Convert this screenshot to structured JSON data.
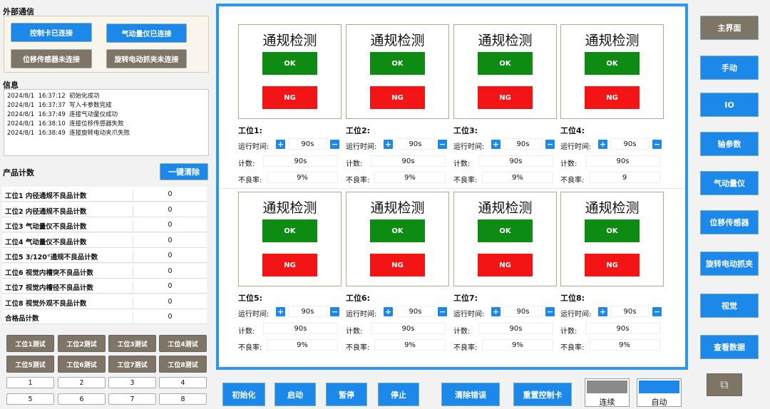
{
  "comm": {
    "title": "外部通信",
    "card_ok": "控制卡已连接",
    "gauge_ok": "气动量仪已连接",
    "disp_no": "位移传感器未连接",
    "grip_no": "旋转电动抓夹未连接"
  },
  "info": {
    "title": "信息",
    "logs": [
      "2024/8/1  16:37:12  初始化成功",
      "2024/8/1  16:37:37  写入卡参数完成",
      "2024/8/1  16:37:49  连接气动量仪成功",
      "2024/8/1  16:38:10  连接位移传感器失败",
      "2024/8/1  16:38:49  连接旋转电动夹爪失败"
    ]
  },
  "count": {
    "title": "产品计数",
    "clear": "一键清除",
    "rows": [
      {
        "label": "工位1  内径通规不良品计数",
        "value": "0"
      },
      {
        "label": "工位2  内径通规不良品计数",
        "value": "0"
      },
      {
        "label": "工位3  气动量仪不良品计数",
        "value": "0"
      },
      {
        "label": "工位4  气动量仪不良品计数",
        "value": "0"
      },
      {
        "label": "工位5  3/120°通规不良品计数",
        "value": "0"
      },
      {
        "label": "工位6  视觉内槽突不良品计数",
        "value": "0"
      },
      {
        "label": "工位7  视觉内槽径不良品计数",
        "value": "0"
      },
      {
        "label": "工位8  视觉外观不良品计数",
        "value": "0"
      },
      {
        "label": "合格品计数",
        "value": "0"
      }
    ]
  },
  "tests": [
    "工位1测试",
    "工位2测试",
    "工位3测试",
    "工位4测试",
    "工位5测试",
    "工位6测试",
    "工位7测试",
    "工位8测试"
  ],
  "nums": [
    "1",
    "2",
    "3",
    "4",
    "5",
    "6",
    "7",
    "8"
  ],
  "stations": [
    {
      "title": "通规检测",
      "ok": "OK",
      "ng": "NG",
      "label": "工位1:",
      "run": "运行时间:",
      "time": "90s",
      "cnt_l": "计数:",
      "cnt": "90s",
      "bad_l": "不良率:",
      "bad": "9%"
    },
    {
      "title": "通规检测",
      "ok": "OK",
      "ng": "NG",
      "label": "工位2:",
      "run": "运行时间:",
      "time": "90s",
      "cnt_l": "计数:",
      "cnt": "90s",
      "bad_l": "不良率:",
      "bad": "9%"
    },
    {
      "title": "通规检测",
      "ok": "OK",
      "ng": "NG",
      "label": "工位3:",
      "run": "运行时间:",
      "time": "90s",
      "cnt_l": "计数:",
      "cnt": "90s",
      "bad_l": "不良率:",
      "bad": "9%"
    },
    {
      "title": "通规检测",
      "ok": "OK",
      "ng": "NG",
      "label": "工位4:",
      "run": "运行时间:",
      "time": "90s",
      "cnt_l": "计数:",
      "cnt": "90s",
      "bad_l": "不良率:",
      "bad": "9"
    },
    {
      "title": "通规检测",
      "ok": "OK",
      "ng": "NG",
      "label": "工位5:",
      "run": "运行时间:",
      "time": "90s",
      "cnt_l": "计数:",
      "cnt": "90s",
      "bad_l": "不良率:",
      "bad": "9%"
    },
    {
      "title": "通规检测",
      "ok": "OK",
      "ng": "NG",
      "label": "工位6:",
      "run": "运行时间:",
      "time": "90s",
      "cnt_l": "计数:",
      "cnt": "90s",
      "bad_l": "不良率:",
      "bad": "9%"
    },
    {
      "title": "通规检测",
      "ok": "OK",
      "ng": "NG",
      "label": "工位7:",
      "run": "运行时间:",
      "time": "90s",
      "cnt_l": "计数:",
      "cnt": "90s",
      "bad_l": "不良率:",
      "bad": "9%"
    },
    {
      "title": "通规检测",
      "ok": "OK",
      "ng": "NG",
      "label": "工位8:",
      "run": "运行时间:",
      "time": "90s",
      "cnt_l": "计数:",
      "cnt": "90s",
      "bad_l": "不良率:",
      "bad": "9%"
    }
  ],
  "bottom": {
    "init": "初始化",
    "start": "启动",
    "pause": "暂停",
    "stop": "停止",
    "clear_err": "清除错误",
    "reset_card": "重置控制卡",
    "cont": "连续",
    "auto": "自动"
  },
  "right": [
    "主界面",
    "手动",
    "IO",
    "轴参数",
    "气动量仪",
    "位移传感器",
    "旋转电动抓夹",
    "视觉",
    "查看数据"
  ],
  "colors": {
    "accent": "#1b88ea",
    "ok": "#0d8b12",
    "ng": "#f31515",
    "idle": "#7e7566"
  }
}
